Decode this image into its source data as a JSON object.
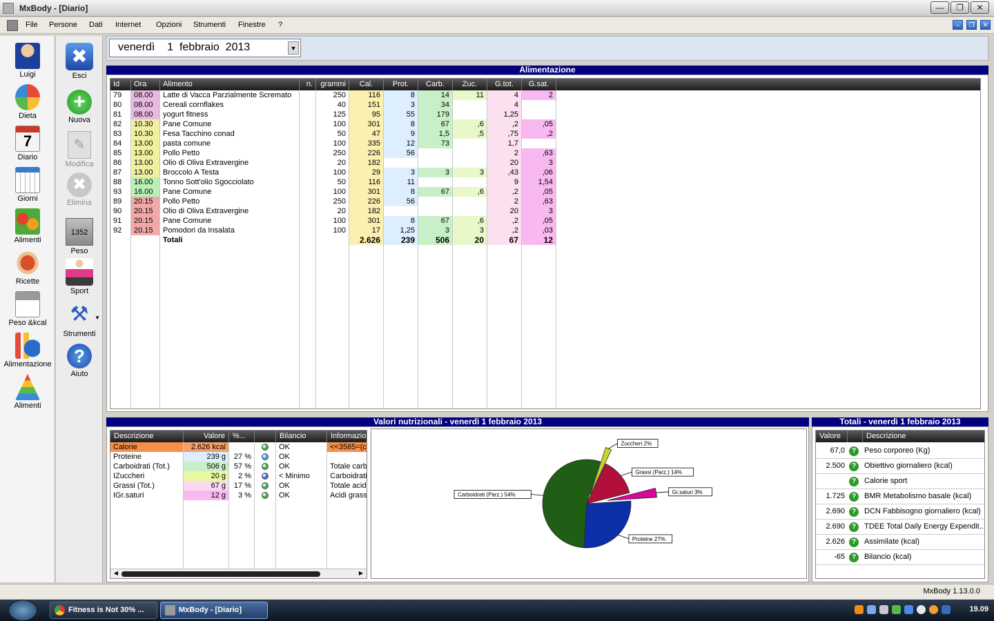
{
  "window": {
    "title": "MxBody - [Diario]"
  },
  "menu": [
    "File",
    "Persone",
    "Dati",
    "Internet",
    "Opzioni",
    "Strumenti",
    "Finestre",
    "?"
  ],
  "left_nav": [
    {
      "label": "Luigi",
      "icon": "user-icon"
    },
    {
      "label": "Dieta",
      "icon": "pie-chart-icon"
    },
    {
      "label": "Diario",
      "icon": "calendar-icon"
    },
    {
      "label": "Giorni",
      "icon": "calendar-grid-icon"
    },
    {
      "label": "Alimenti",
      "icon": "vegetables-icon"
    },
    {
      "label": "Ricette",
      "icon": "pasta-icon"
    },
    {
      "label": "Peso &kcal",
      "icon": "scale-chart-icon"
    },
    {
      "label": "Alimentazione",
      "icon": "bar-pie-chart-icon"
    },
    {
      "label": "Alimenti",
      "icon": "food-pyramid-icon"
    }
  ],
  "toolbar": [
    {
      "label": "Esci",
      "icon": "close-icon",
      "enabled": true
    },
    {
      "label": "Nuova",
      "icon": "plus-icon",
      "enabled": true
    },
    {
      "label": "Modifica",
      "icon": "edit-icon",
      "enabled": false
    },
    {
      "label": "Elimina",
      "icon": "delete-icon",
      "enabled": false
    },
    {
      "label": "Peso",
      "icon": "scale-icon",
      "enabled": true
    },
    {
      "label": "Sport",
      "icon": "runner-icon",
      "enabled": true
    },
    {
      "label": "Strumenti",
      "icon": "tools-icon",
      "enabled": true
    },
    {
      "label": "Aiuto",
      "icon": "help-icon",
      "enabled": true
    }
  ],
  "date": {
    "weekday": "venerdì",
    "day": "1",
    "month": "febbraio",
    "year": "2013"
  },
  "food_section_title": "Alimentazione",
  "food_columns": [
    "Id",
    "Ora",
    "Alimento",
    "n.",
    "grammi",
    "Cal.",
    "Prot.",
    "Carb.",
    "Zuc.",
    "G.tot.",
    "G.sat."
  ],
  "food_rows": [
    [
      "79",
      "08.00",
      "Latte di Vacca Parzialmente Scremato",
      "",
      "250",
      "116",
      "8",
      "14",
      "11",
      "4",
      "2"
    ],
    [
      "80",
      "08.00",
      "Cereali cornflakes",
      "",
      "40",
      "151",
      "3",
      "34",
      "",
      "4",
      ""
    ],
    [
      "81",
      "08.00",
      "yogurt fitness",
      "",
      "125",
      "95",
      "55",
      "179",
      "",
      "1,25",
      ""
    ],
    [
      "82",
      "10.30",
      "Pane Comune",
      "",
      "100",
      "301",
      "8",
      "67",
      ",6",
      ",2",
      ",05"
    ],
    [
      "83",
      "10.30",
      "Fesa Tacchino conad",
      "",
      "50",
      "47",
      "9",
      "1,5",
      ",5",
      ",75",
      ",2"
    ],
    [
      "84",
      "13.00",
      "pasta comune",
      "",
      "100",
      "335",
      "12",
      "73",
      "",
      "1,7",
      ""
    ],
    [
      "85",
      "13.00",
      "Pollo Petto",
      "",
      "250",
      "226",
      "56",
      "",
      "",
      "2",
      ",63"
    ],
    [
      "86",
      "13.00",
      "Olio di Oliva Extravergine",
      "",
      "20",
      "182",
      "",
      "",
      "",
      "20",
      "3"
    ],
    [
      "87",
      "13.00",
      "Broccolo A Testa",
      "",
      "100",
      "29",
      "3",
      "3",
      "3",
      ",43",
      ",06"
    ],
    [
      "88",
      "16.00",
      "Tonno Sott'olio Sgocciolato",
      "",
      "50",
      "116",
      "11",
      "",
      "",
      "9",
      "1,54"
    ],
    [
      "93",
      "16.00",
      "Pane Comune",
      "",
      "100",
      "301",
      "8",
      "67",
      ",6",
      ",2",
      ",05"
    ],
    [
      "89",
      "20.15",
      "Pollo Petto",
      "",
      "250",
      "226",
      "56",
      "",
      "",
      "2",
      ",63"
    ],
    [
      "90",
      "20.15",
      "Olio di Oliva Extravergine",
      "",
      "20",
      "182",
      "",
      "",
      "",
      "20",
      "3"
    ],
    [
      "91",
      "20.15",
      "Pane Comune",
      "",
      "100",
      "301",
      "8",
      "67",
      ",6",
      ",2",
      ",05"
    ],
    [
      "92",
      "20.15",
      "Pomodori da Insalata",
      "",
      "100",
      "17",
      "1,25",
      "3",
      "3",
      ",2",
      ",03"
    ]
  ],
  "food_totals": {
    "label": "Totali",
    "values": [
      "2.626",
      "239",
      "506",
      "20",
      "67",
      "12"
    ]
  },
  "colors": {
    "ora_morning": "#e8b8e0",
    "ora_mid": "#f0f0a0",
    "ora_afternoon": "#b8f0b8",
    "ora_evening": "#f0a8a8",
    "cal": "#fbf0b0",
    "prot": "#ddeeff",
    "carb": "#c8f0c8",
    "zuc": "#e8f8c8",
    "gtot": "#fbe0f0",
    "gsat": "#f8b8f0",
    "accent": "#000080"
  },
  "nutr_section_title": "Valori nutrizionali - venerdì 1 febbraio 2013",
  "nutr_columns": [
    "Descrizione",
    "Valore",
    "%...",
    "",
    "Bilancio",
    "Informazio"
  ],
  "nutr_rows": [
    {
      "desc": "Calorie",
      "value": "2.626 kcal",
      "pct": "",
      "dot": "#3cb043",
      "bal": "OK",
      "info": "<<3585=(c"
    },
    {
      "desc": "Proteine",
      "value": "239 g",
      "pct": "27 %",
      "dot": "#3b9fd9",
      "bal": "OK",
      "info": ""
    },
    {
      "desc": "Carboidrati (Tot.)",
      "value": "506 g",
      "pct": "57 %",
      "dot": "#3cb043",
      "bal": "OK",
      "info": "Totale carb"
    },
    {
      "desc": "IZuccheri",
      "value": "20 g",
      "pct": "2 %",
      "dot": "#4b6bdc",
      "bal": "< Minimo",
      "info": "Carboidrati"
    },
    {
      "desc": "Grassi (Tot.)",
      "value": "67 g",
      "pct": "17 %",
      "dot": "#3cb043",
      "bal": "OK",
      "info": "Totale acid"
    },
    {
      "desc": "IGr.saturi",
      "value": "12 g",
      "pct": "3 %",
      "dot": "#3cb043",
      "bal": "OK",
      "info": "Acidi grassi"
    }
  ],
  "chart_data": {
    "type": "pie",
    "title": "",
    "slices": [
      {
        "label": "Carboidrati (Parz.) 54%",
        "value": 54,
        "color": "#1f5e14"
      },
      {
        "label": "Zuccheri 2%",
        "value": 2,
        "color": "#c8d42a"
      },
      {
        "label": "Grassi (Parz.) 14%",
        "value": 14,
        "color": "#b0103a"
      },
      {
        "label": "Gr.saturi 3%",
        "value": 3,
        "color": "#d6089a"
      },
      {
        "label": "Proteine 27%",
        "value": 27,
        "color": "#0c2fa8"
      }
    ]
  },
  "tot_section_title": "Totali - venerdì 1 febbraio 2013",
  "tot_columns": [
    "Valore",
    "",
    "Descrizione"
  ],
  "tot_rows": [
    {
      "value": "67,0",
      "desc": "Peso corporeo (Kg)"
    },
    {
      "value": "2.500",
      "desc": "Obiettivo giornaliero (kcal)"
    },
    {
      "value": "",
      "desc": "Calorie sport"
    },
    {
      "value": "1.725",
      "desc": "BMR Metabolismo basale (kcal)"
    },
    {
      "value": "2.690",
      "desc": "DCN Fabbisogno giornaliero (kcal)"
    },
    {
      "value": "2.690",
      "desc": "TDEE Total Daily Energy Expendit..."
    },
    {
      "value": "2.626",
      "desc": "Assimilate (kcal)"
    },
    {
      "value": "-65",
      "desc": "Bilancio (kcal)"
    }
  ],
  "status": {
    "version": "MxBody 1.13.0.0"
  },
  "taskbar": {
    "tasks": [
      "Fitness is Not 30% ...",
      "MxBody - [Diario]"
    ],
    "clock": "19.09"
  }
}
